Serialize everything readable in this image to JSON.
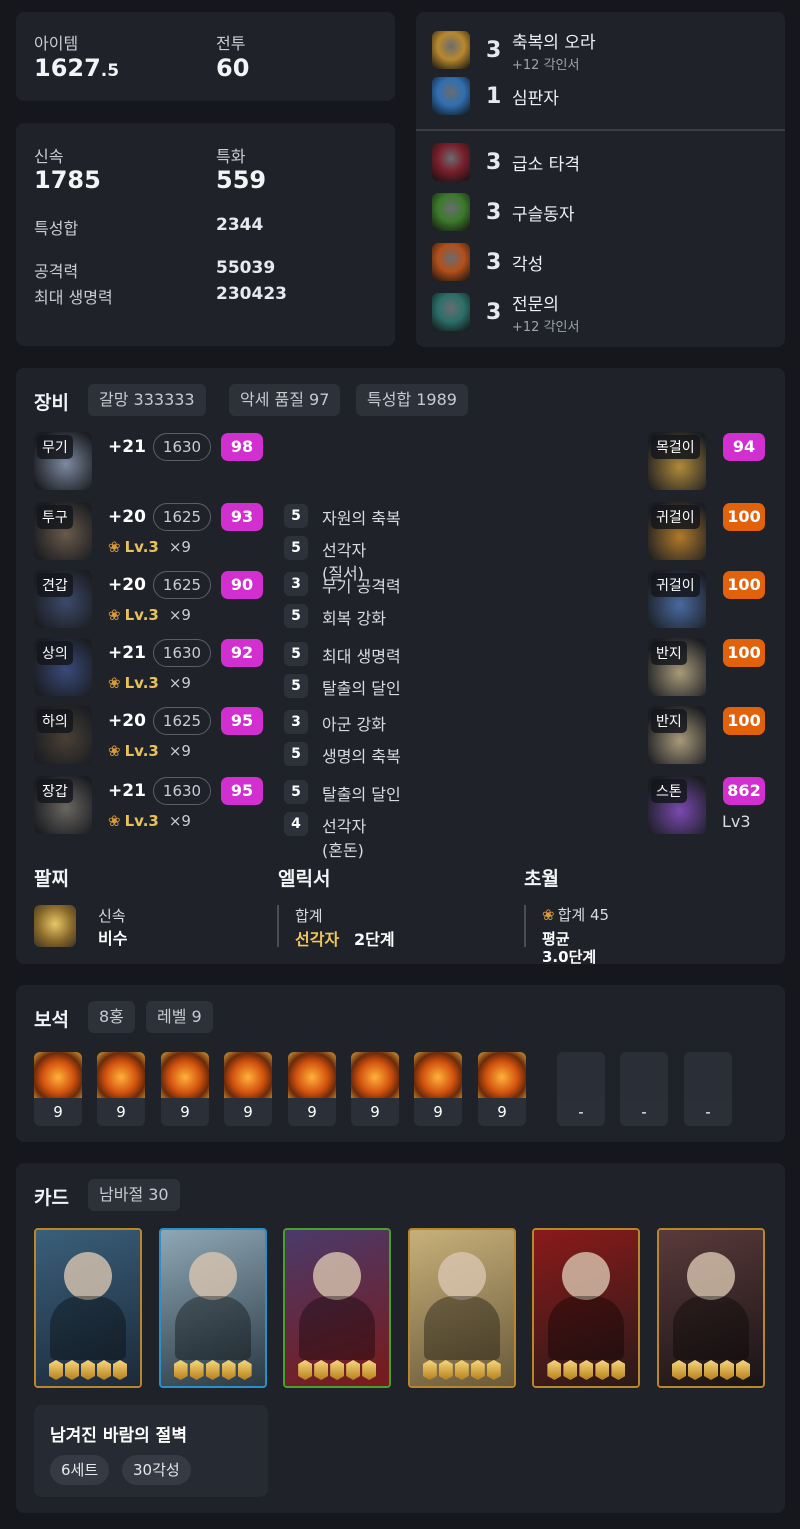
{
  "stats": {
    "item_label": "아이템",
    "item_value_main": "1627",
    "item_value_frac": ".5",
    "combat_label": "전투",
    "combat_value": "60"
  },
  "attrs": {
    "swift_label": "신속",
    "swift_value": "1785",
    "spec_label": "특화",
    "spec_value": "559",
    "sum_label": "특성합",
    "sum_value": "2344",
    "atk_label": "공격력",
    "atk_value": "55039",
    "hp_label": "최대 생명력",
    "hp_value": "230423"
  },
  "engravings": [
    {
      "level": "3",
      "name": "축복의 오라",
      "sub": "+12 각인서",
      "icon": "golden-aura-icon",
      "color": "#b8892e"
    },
    {
      "level": "1",
      "name": "심판자",
      "sub": "",
      "icon": "blue-judge-icon",
      "color": "#2f6fb3"
    },
    {
      "level": "3",
      "name": "급소 타격",
      "sub": "",
      "icon": "red-strike-icon",
      "color": "#7a1f2c"
    },
    {
      "level": "3",
      "name": "구슬동자",
      "sub": "",
      "icon": "green-orb-icon",
      "color": "#3c7a2a"
    },
    {
      "level": "3",
      "name": "각성",
      "sub": "",
      "icon": "orange-awaken-icon",
      "color": "#b4501a"
    },
    {
      "level": "3",
      "name": "전문의",
      "sub": "+12 각인서",
      "icon": "teal-expert-icon",
      "color": "#2b6f6a"
    }
  ],
  "equipment": {
    "title": "장비",
    "tags": [
      "갈망 333333",
      "악세 품질 97",
      "특성합 1989"
    ],
    "items": [
      {
        "slot": "무기",
        "refine": "+21",
        "ilvl": "1630",
        "quality": "98",
        "lv": "",
        "count": ""
      },
      {
        "slot": "투구",
        "refine": "+20",
        "ilvl": "1625",
        "quality": "93",
        "lv": "Lv.3",
        "count": "×9"
      },
      {
        "slot": "견갑",
        "refine": "+20",
        "ilvl": "1625",
        "quality": "90",
        "lv": "Lv.3",
        "count": "×9"
      },
      {
        "slot": "상의",
        "refine": "+21",
        "ilvl": "1630",
        "quality": "92",
        "lv": "Lv.3",
        "count": "×9"
      },
      {
        "slot": "하의",
        "refine": "+20",
        "ilvl": "1625",
        "quality": "95",
        "lv": "Lv.3",
        "count": "×9"
      },
      {
        "slot": "장갑",
        "refine": "+21",
        "ilvl": "1630",
        "quality": "95",
        "lv": "Lv.3",
        "count": "×9"
      }
    ],
    "effects": [
      {
        "n": "5",
        "name": "자원의 축복"
      },
      {
        "n": "5",
        "name": "선각자"
      },
      {
        "n": "3",
        "name": "무기 공격력"
      },
      {
        "n": "5",
        "name": "회복 강화"
      },
      {
        "n": "5",
        "name": "최대 생명력"
      },
      {
        "n": "5",
        "name": "탈출의 달인"
      },
      {
        "n": "3",
        "name": "아군 강화"
      },
      {
        "n": "5",
        "name": "생명의 축복"
      },
      {
        "n": "5",
        "name": "탈출의 달인"
      },
      {
        "n": "4",
        "name": "선각자"
      }
    ],
    "effect_notes": {
      "order": "(질서)",
      "chaos": "(혼돈)"
    },
    "accessories": [
      {
        "slot": "목걸이",
        "quality": "94",
        "color": "mag"
      },
      {
        "slot": "귀걸이",
        "quality": "100",
        "color": "org"
      },
      {
        "slot": "귀걸이",
        "quality": "100",
        "color": "org"
      },
      {
        "slot": "반지",
        "quality": "100",
        "color": "org"
      },
      {
        "slot": "반지",
        "quality": "100",
        "color": "org"
      },
      {
        "slot": "스톤",
        "quality": "862",
        "color": "mag",
        "sub": "Lv3"
      }
    ],
    "bracelet": {
      "title": "팔찌",
      "stat": "신속",
      "rank": "비수"
    },
    "elixir": {
      "title": "엘릭서",
      "label": "합계",
      "name": "선각자",
      "stage": "2단계"
    },
    "transcend": {
      "title": "초월",
      "total": "합계 45",
      "avg_label": "평균",
      "avg_value": "3.0단계"
    }
  },
  "gems": {
    "title": "보석",
    "tags": [
      "8홍",
      "레벨 9"
    ],
    "levels": [
      "9",
      "9",
      "9",
      "9",
      "9",
      "9",
      "9",
      "9",
      "-",
      "-",
      "-"
    ]
  },
  "cards": {
    "title": "카드",
    "tag": "남바절 30",
    "set_name": "남겨진 바람의 절벽",
    "set_tags": [
      "6세트",
      "30각성"
    ],
    "items": [
      {
        "name": "card-1",
        "border": "#b8862b",
        "c1": "#3a5f7a",
        "c2": "#1c2a3a"
      },
      {
        "name": "card-2",
        "border": "#2d8fc7",
        "c1": "#8fa7b5",
        "c2": "#2a3a44"
      },
      {
        "name": "card-3",
        "border": "#4aa02c",
        "c1": "#4a3a6a",
        "c2": "#7a1a1a"
      },
      {
        "name": "card-4",
        "border": "#b8862b",
        "c1": "#c7b07a",
        "c2": "#6a5a3a"
      },
      {
        "name": "card-5",
        "border": "#b8862b",
        "c1": "#8a1a1a",
        "c2": "#2a1a1a"
      },
      {
        "name": "card-6",
        "border": "#b8862b",
        "c1": "#5a3a3a",
        "c2": "#1a1416"
      }
    ],
    "awaken": [
      5,
      5,
      5,
      5,
      5,
      5
    ]
  }
}
